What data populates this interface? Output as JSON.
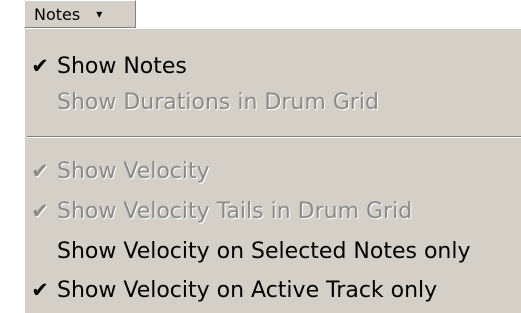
{
  "trigger": {
    "label": "Notes",
    "arrow": "▾"
  },
  "menu": {
    "check_glyph": "✔",
    "items": [
      {
        "label": "Show Notes",
        "checked": true,
        "enabled": true
      },
      {
        "label": "Show Durations in Drum Grid",
        "checked": false,
        "enabled": false
      },
      {
        "label": "Show Velocity",
        "checked": true,
        "enabled": false
      },
      {
        "label": "Show Velocity Tails in Drum Grid",
        "checked": true,
        "enabled": false
      },
      {
        "label": "Show Velocity on Selected Notes only",
        "checked": false,
        "enabled": true
      },
      {
        "label": "Show Velocity on Active Track only",
        "checked": true,
        "enabled": true
      }
    ]
  },
  "colors": {
    "menu_background": "#d4d0c8",
    "enabled_text": "#000000",
    "disabled_text": "#8a8a8a"
  }
}
